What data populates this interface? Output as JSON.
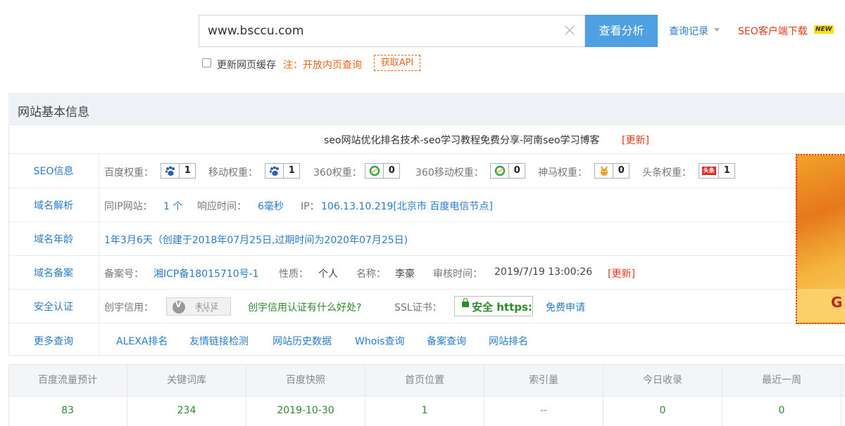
{
  "search": {
    "value": "www.bsccu.com",
    "button": "查看分析"
  },
  "header_links": {
    "history": "查询记录",
    "seo_client": "SEO客户端下载",
    "new_badge": "NEW"
  },
  "options": {
    "cache_label": "更新网页缓存",
    "note": "注：开放内页查询",
    "api": "获取API"
  },
  "panel": {
    "title": "网站基本信息",
    "site_title": "seo网站优化排名技术-seo学习教程免费分享-阿南seo学习博客",
    "site_title_update": "[更新]",
    "rows": {
      "seo": {
        "label": "SEO信息",
        "items": [
          {
            "label": "百度权重：",
            "value": "1",
            "icon": "baidu-paw-icon"
          },
          {
            "label": "移动权重：",
            "value": "1",
            "icon": "baidu-paw-icon"
          },
          {
            "label": "360权重：",
            "value": "0",
            "icon": "360-icon"
          },
          {
            "label": "360移动权重：",
            "value": "0",
            "icon": "360-icon"
          },
          {
            "label": "神马权重：",
            "value": "0",
            "icon": "shenma-icon"
          },
          {
            "label": "头条权重：",
            "value": "1",
            "icon": "toutiao-icon"
          }
        ],
        "toutiao_icon_text": "头条"
      },
      "dns": {
        "label": "域名解析",
        "same_ip_label": "同IP网站：",
        "same_ip_value": "1 个",
        "response_label": "响应时间：",
        "response_value": "6毫秒",
        "ip_label": "IP：",
        "ip_value": "106.13.10.219[北京市 百度电信节点]"
      },
      "age": {
        "label": "域名年龄",
        "value": "1年3月6天（创建于2018年07月25日,过期时间为2020年07月25日)"
      },
      "icp": {
        "label": "域名备案",
        "no_label": "备案号：",
        "no_value": "湘ICP备18015710号-1",
        "type_label": "性质：",
        "type_value": "个人",
        "name_label": "名称：",
        "name_value": "李豪",
        "time_label": "审核时间：",
        "time_value": "2019/7/19 13:00:26",
        "update": "[更新]"
      },
      "security": {
        "label": "安全认证",
        "chuangyu_label": "创宇信用：",
        "chuangyu_badge": "未认证",
        "chuangyu_badge_icon_letter": "V",
        "chuangyu_badge_stars": "★★★★",
        "chuangyu_link": "创宇信用认证有什么好处?",
        "ssl_label": "SSL证书：",
        "ssl_badge": "安全 https:",
        "ssl_apply": "免费申请"
      },
      "more": {
        "label": "更多查询",
        "links": [
          "ALEXA排名",
          "友情链接检测",
          "网站历史数据",
          "Whois查询",
          "备案查询",
          "网站排名"
        ]
      }
    }
  },
  "ad": {
    "letter": "G"
  },
  "stats": {
    "headers": [
      "百度流量预计",
      "关键词库",
      "百度快照",
      "首页位置",
      "索引量",
      "今日收录",
      "最近一周"
    ],
    "values": [
      "83",
      "234",
      "2019-10-30",
      "1",
      "--",
      "0",
      "0"
    ]
  },
  "colors": {
    "accent": "#4ea0e0",
    "link": "#2a7cc7",
    "red": "#e03a1a",
    "orange": "#e8671b",
    "green": "#2d8a2d"
  }
}
